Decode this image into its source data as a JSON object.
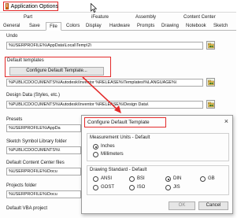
{
  "window": {
    "title": "Application Options",
    "icon": "inventor-app-icon"
  },
  "tabs": {
    "row1": [
      {
        "label": "Part"
      },
      {
        "label": "iFeature"
      },
      {
        "label": "Assembly"
      },
      {
        "label": "Content Center"
      }
    ],
    "row2": [
      {
        "label": "General"
      },
      {
        "label": "Save"
      },
      {
        "label": "File",
        "active": true
      },
      {
        "label": "Colors"
      },
      {
        "label": "Display"
      },
      {
        "label": "Hardware"
      },
      {
        "label": "Prompts"
      },
      {
        "label": "Drawing"
      },
      {
        "label": "Notebook"
      },
      {
        "label": "Sketch"
      }
    ]
  },
  "file_tab": {
    "undo": {
      "label": "Undo",
      "value": "%USERPROFILE%\\AppData\\Local\\Temp\\2\\"
    },
    "default_templates": {
      "label": "Default templates",
      "button": "Configure Default Template...",
      "value": "%PUBLICDOCUMENTS%\\Autodesk\\Inventor %RELEASE%\\Templates\\%LANGUAGE%\\"
    },
    "design_data": {
      "label": "Design Data (Styles, etc.)",
      "value": "%PUBLICDOCUMENTS%\\Autodesk\\Inventor %RELEASE%\\Design Data\\"
    },
    "presets": {
      "label": "Presets",
      "value": "%USERPROFILE%\\AppDa"
    },
    "sketch_symbol": {
      "label": "Sketch Symbol Library folder",
      "value": "%PUBLICDOCUMENTS%\\"
    },
    "content_center": {
      "label": "Default Content Center files",
      "value": "%USERPROFILE%\\Docu"
    },
    "projects": {
      "label": "Projects folder",
      "value": "%USERPROFILE%\\Docu"
    },
    "vba": {
      "label": "Default VBA project"
    }
  },
  "dialog": {
    "title": "Configure Default Template",
    "close_icon": "close-icon",
    "units": {
      "label": "Measurement Units - Default",
      "options": [
        {
          "label": "Inches",
          "checked": true
        },
        {
          "label": "Millimeters",
          "checked": false
        }
      ]
    },
    "standard": {
      "label": "Drawing Standard - Default",
      "options": [
        {
          "label": "ANSI",
          "checked": false
        },
        {
          "label": "BSI",
          "checked": false
        },
        {
          "label": "DIN",
          "checked": true
        },
        {
          "label": "GB",
          "checked": false
        },
        {
          "label": "GOST",
          "checked": false
        },
        {
          "label": "ISO",
          "checked": false
        },
        {
          "label": "JIS",
          "checked": false
        }
      ]
    },
    "ok": "OK",
    "cancel": "Cancel"
  },
  "colors": {
    "highlight": "#e32b2b",
    "accent_icon": "#e46c0a"
  }
}
